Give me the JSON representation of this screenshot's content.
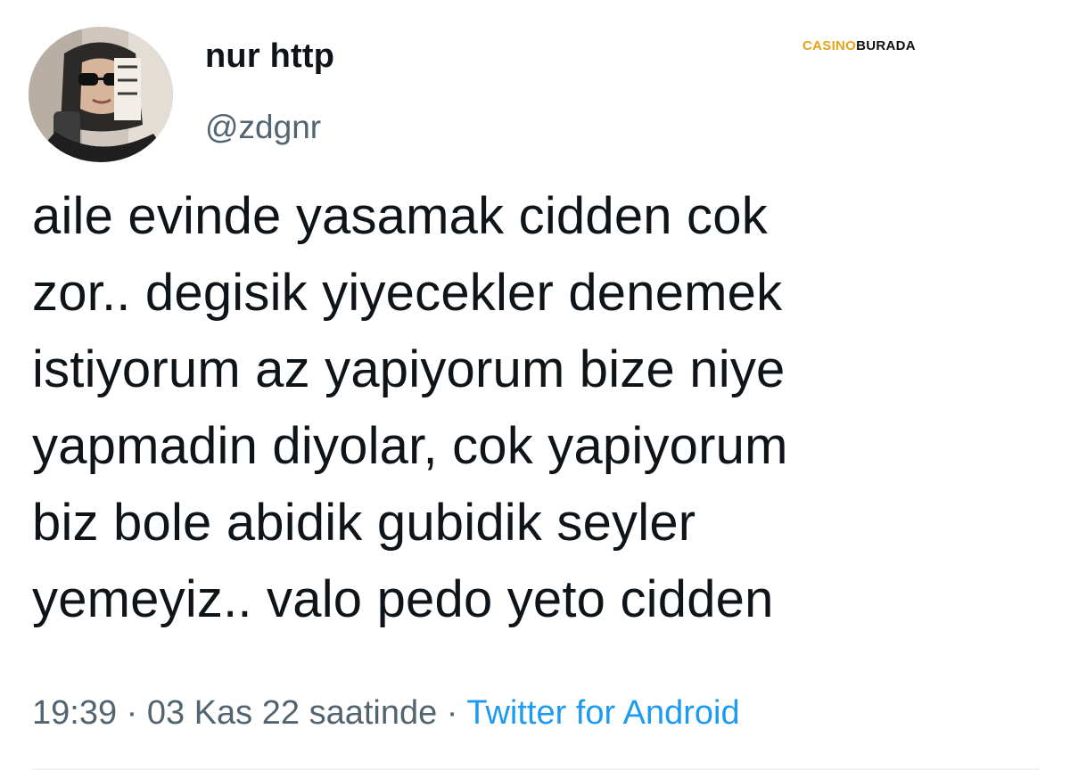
{
  "watermark": {
    "part1": "CASINO",
    "part2": "BURADA",
    "color_part1": "#e8a317",
    "color_part2": "#111111"
  },
  "tweet": {
    "user": {
      "display_name": "nur http",
      "handle": "@zdgnr",
      "avatar_icon": "profile-photo"
    },
    "text_lines": [
      "aile evinde yasamak cidden cok",
      "zor.. degisik yiyecekler denemek",
      "istiyorum az yapiyorum bize niye",
      "yapmadin diyolar, cok yapiyorum",
      "biz bole abidik gubidik seyler",
      "yemeyiz.. valo pedo yeto cidden"
    ],
    "meta": {
      "time": "19:39",
      "separator": "·",
      "date": "03 Kas 22 saatinde",
      "source": "Twitter for Android"
    }
  },
  "colors": {
    "text": "#0f1419",
    "secondary": "#536471",
    "link": "#1d9bf0"
  }
}
